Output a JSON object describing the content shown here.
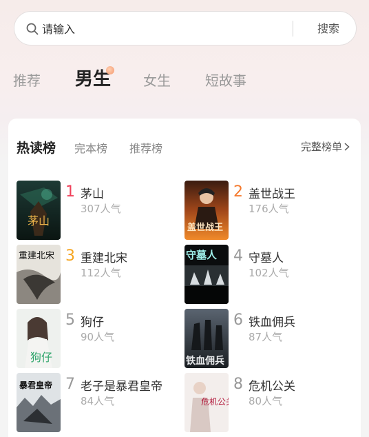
{
  "search": {
    "placeholder": "请输入",
    "button_label": "搜索"
  },
  "gender_tabs": [
    {
      "label": "推荐",
      "active": false
    },
    {
      "label": "男生",
      "active": true
    },
    {
      "label": "女生",
      "active": false
    },
    {
      "label": "短故事",
      "active": false
    }
  ],
  "ranking": {
    "tabs": [
      {
        "label": "热读榜",
        "active": true
      },
      {
        "label": "完本榜",
        "active": false
      },
      {
        "label": "推荐榜",
        "active": false
      }
    ],
    "full_list_label": "完整榜单",
    "rank_colors": {
      "1": "#f0405a",
      "2": "#f57a2e",
      "3": "#f5a623",
      "other": "#999999"
    },
    "books": [
      {
        "rank": "1",
        "title": "茅山",
        "popularity": "307人气",
        "cover_icon": "maoshan-cover",
        "cover_text": "茅山"
      },
      {
        "rank": "2",
        "title": "盖世战王",
        "popularity": "176人气",
        "cover_icon": "gaishi-zhanwang-cover",
        "cover_text": "盖世战王"
      },
      {
        "rank": "3",
        "title": "重建北宋",
        "popularity": "112人气",
        "cover_icon": "chongjian-beisong-cover",
        "cover_text": "重建北宋"
      },
      {
        "rank": "4",
        "title": "守墓人",
        "popularity": "102人气",
        "cover_icon": "shoumuren-cover",
        "cover_text": "守墓人"
      },
      {
        "rank": "5",
        "title": "狗仔",
        "popularity": "90人气",
        "cover_icon": "gouzai-cover",
        "cover_text": "狗仔"
      },
      {
        "rank": "6",
        "title": "铁血佣兵",
        "popularity": "87人气",
        "cover_icon": "tiexue-yongbing-cover",
        "cover_text": "铁血佣兵"
      },
      {
        "rank": "7",
        "title": "老子是暴君皇帝",
        "popularity": "84人气",
        "cover_icon": "baojun-huangdi-cover",
        "cover_text": "暴君皇帝"
      },
      {
        "rank": "8",
        "title": "危机公关",
        "popularity": "80人气",
        "cover_icon": "weiji-gongguan-cover",
        "cover_text": "危机公关"
      }
    ]
  }
}
